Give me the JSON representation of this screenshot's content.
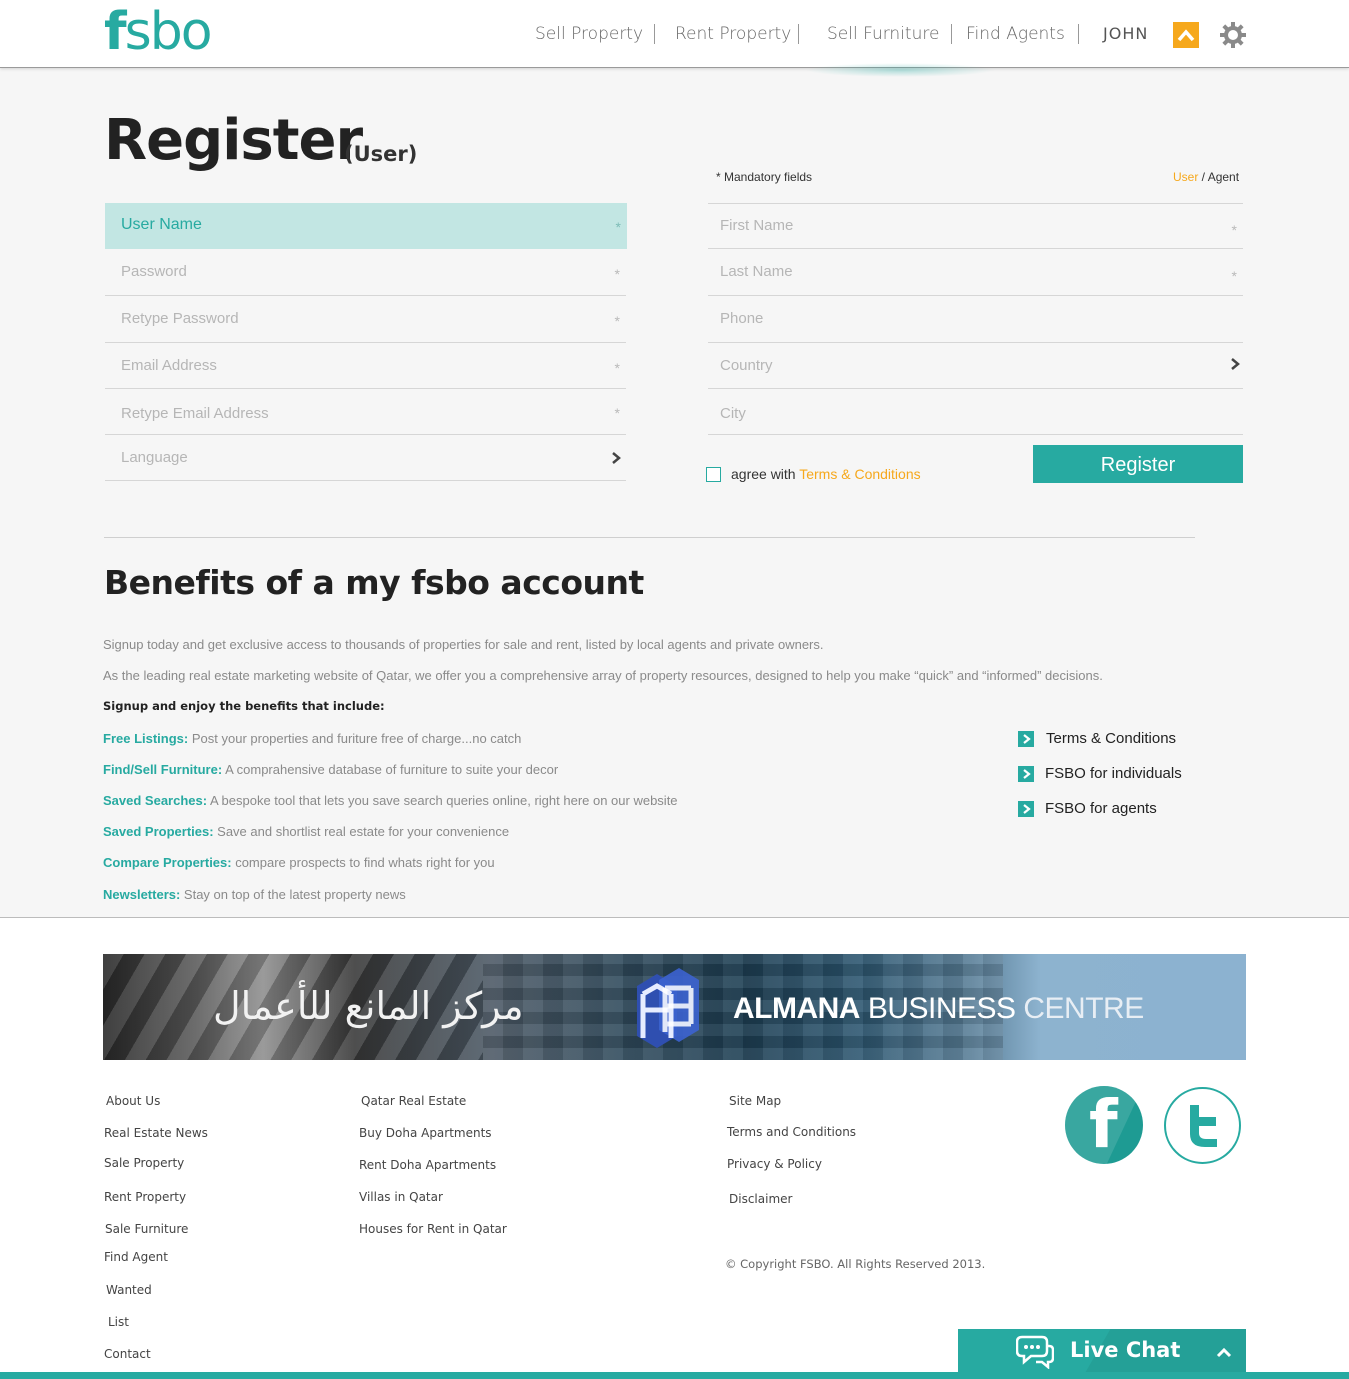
{
  "header": {
    "logo": {
      "f": "f",
      "rest": "sbo"
    },
    "nav": [
      "Sell Property",
      "Rent Property",
      "Sell Furniture",
      "Find Agents"
    ],
    "user": "JOHN",
    "icons": {
      "up": "arrow-up-icon",
      "settings": "gear-icon"
    },
    "accent": "#27aaa1",
    "highlight": "#f6a81c"
  },
  "register": {
    "title": "Register",
    "subtitle": "(User)",
    "mandatory": "* Mandatory fields",
    "switch": {
      "user": "User",
      "sep": " / ",
      "agent": "Agent"
    },
    "left_fields": [
      {
        "placeholder": "User Name",
        "required": "*"
      },
      {
        "placeholder": "Password",
        "required": "*"
      },
      {
        "placeholder": "Retype Password",
        "required": "*"
      },
      {
        "placeholder": "Email Address",
        "required": "*"
      },
      {
        "placeholder": "Retype Email Address",
        "required": "*"
      },
      {
        "placeholder": "Language"
      }
    ],
    "right_fields": [
      {
        "placeholder": "First Name",
        "required": "*"
      },
      {
        "placeholder": "Last Name",
        "required": "*"
      },
      {
        "placeholder": "Phone"
      },
      {
        "placeholder": "Country"
      },
      {
        "placeholder": "City"
      }
    ],
    "agree_prefix": "agree with ",
    "agree_link": "Terms & Conditions",
    "button": "Register"
  },
  "benefits": {
    "title": "Benefits of a my fsbo account",
    "paragraphs": [
      "Signup today and get exclusive access to thousands of properties for sale and rent, listed by local agents and private owners.",
      "As the leading real estate marketing website of Qatar, we offer you a comprehensive array of property resources, designed to help you make “quick” and “informed” decisions."
    ],
    "intro": "Signup and enjoy the benefits that include:",
    "items": [
      {
        "key": "Free Listings:",
        "text": " Post your properties and furiture free of charge...no catch"
      },
      {
        "key": "Find/Sell Furniture:",
        "text": " A comprahensive database of furniture to suite your decor"
      },
      {
        "key": "Saved Searches:",
        "text": " A bespoke tool that lets you save search queries online, right here on our website"
      },
      {
        "key": "Saved Properties:",
        "text": " Save and shortlist real estate for your convenience"
      },
      {
        "key": "Compare Properties:",
        "text": " compare prospects to find whats right for you"
      },
      {
        "key": "Newsletters:",
        "text": " Stay on top of the latest property news"
      }
    ],
    "side_links": [
      "Terms & Conditions",
      "FSBO for individuals",
      "FSBO for agents"
    ]
  },
  "banner": {
    "arabic": "مركز المانع للأعمال",
    "name_bold": "ALMANA",
    "name_mid": " BUSINESS ",
    "name_end": "CENTRE"
  },
  "footer": {
    "col1": [
      "About Us",
      "Real Estate News",
      "Sale Property",
      "Rent Property",
      "Sale Furniture",
      "Find Agent",
      "Wanted",
      "List",
      "Contact"
    ],
    "col2": [
      "Qatar Real Estate",
      "Buy Doha Apartments",
      "Rent Doha Apartments",
      "Villas in Qatar",
      "Houses for Rent in Qatar"
    ],
    "col3": [
      "Site Map",
      "Terms and Conditions",
      "Privacy & Policy",
      "Disclaimer"
    ],
    "copyright": "© Copyright FSBO. All Rights Reserved 2013.",
    "social": {
      "facebook": "f",
      "twitter_icon": "twitter-icon"
    },
    "live_chat": "Live Chat"
  }
}
